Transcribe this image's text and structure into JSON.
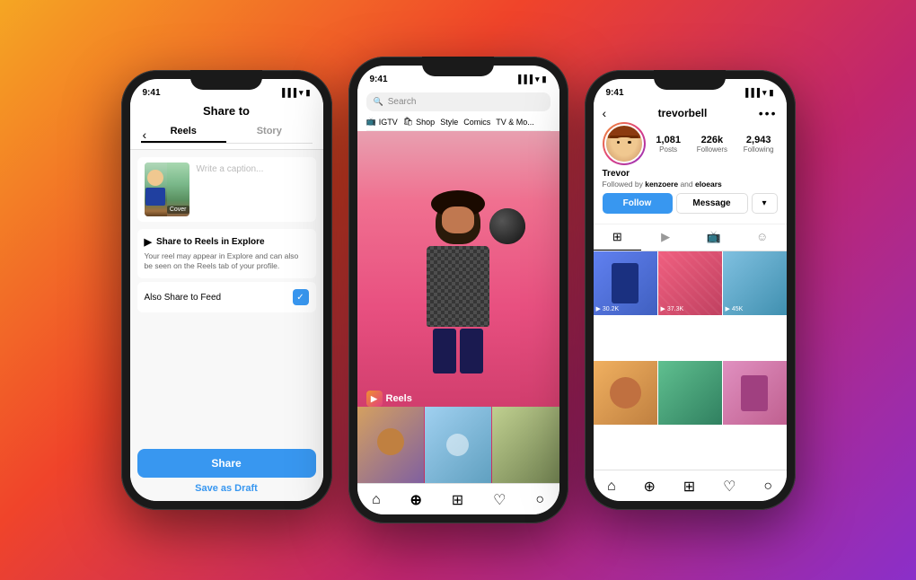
{
  "background": {
    "gradient": "135deg, #f5a623 0%, #f0442a 35%, #c0266e 65%, #8b2fc9 100%"
  },
  "phone1": {
    "status_time": "9:41",
    "title": "Share to",
    "tab_reels": "Reels",
    "tab_story": "Story",
    "caption_placeholder": "Write a caption...",
    "cover_label": "Cover",
    "share_to_reels_title": "Share to Reels in Explore",
    "share_to_reels_desc": "Your reel may appear in Explore and can also be seen on the Reels tab of your profile.",
    "also_share_label": "Also Share to Feed",
    "share_button": "Share",
    "save_draft_button": "Save as Draft"
  },
  "phone2": {
    "status_time": "9:41",
    "search_placeholder": "Search",
    "tags": [
      "IGTV",
      "Shop",
      "Style",
      "Comics",
      "TV & Movie"
    ],
    "reels_label": "Reels",
    "nav_items": [
      "home",
      "search",
      "plus",
      "heart",
      "person"
    ]
  },
  "phone3": {
    "status_time": "9:41",
    "username": "trevorbell",
    "posts_count": "1,081",
    "posts_label": "Posts",
    "followers_count": "226k",
    "followers_label": "Followers",
    "following_count": "2,943",
    "following_label": "Following",
    "name": "Trevor",
    "followed_by": "Followed by kenzoere and eloears",
    "follow_button": "Follow",
    "message_button": "Message",
    "grid_stats": [
      "30.2K",
      "37.3K",
      "45K"
    ],
    "nav_items": [
      "home",
      "search",
      "plus",
      "heart",
      "person"
    ]
  }
}
